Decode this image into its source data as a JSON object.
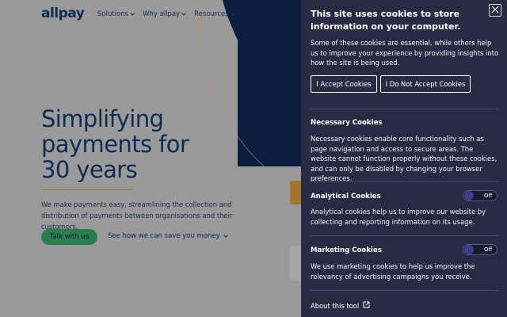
{
  "site": {
    "logo": "allpay",
    "nav": [
      {
        "label": "Solutions"
      },
      {
        "label": "Why allpay"
      },
      {
        "label": "Resources"
      }
    ],
    "hero": {
      "title_lines": [
        "Simplifying",
        "payments for",
        "30 years"
      ],
      "description": "We make payments easy, streamlining the collection and distribution of payments between organisations and their customers.",
      "cta_primary": "Talk with us",
      "cta_secondary": "See how we can save you money"
    }
  },
  "cookie_panel": {
    "title": "This site uses cookies to store information on your computer.",
    "intro": "Some of these cookies are essential, while others help us to improve your experience by providing insights into how the site is being used.",
    "accept_label": "I Accept Cookies",
    "decline_label": "I Do Not Accept Cookies",
    "sections": [
      {
        "heading": "Necessary Cookies",
        "body": "Necessary cookies enable core functionality such as page navigation and access to secure areas. The website cannot function properly without these cookies, and can only be disabled by changing your browser preferences."
      },
      {
        "heading": "Analytical Cookies",
        "body": "Analytical cookies help us to improve our website by collecting and reporting information on its usage.",
        "toggle_label": "Off"
      },
      {
        "heading": "Marketing Cookies",
        "body": "We use marketing cookies to help us improve the relevancy of advertising campaigns you receive.",
        "toggle_label": "Off"
      }
    ],
    "about_label": "About this tool"
  },
  "colors": {
    "panel_bg": "#2b2a45",
    "brand_navy": "#0c1d3f",
    "brand_green": "#2a7d4f",
    "accent_gold": "#a97a2e"
  },
  "icons": {
    "close": "close-icon",
    "external_link": "external-link-icon",
    "chevron": "chevron-down-icon"
  }
}
